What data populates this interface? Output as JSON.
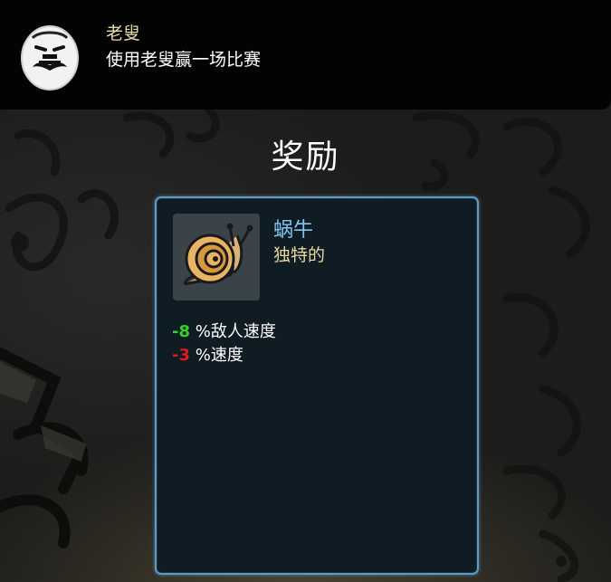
{
  "banner": {
    "character_name": "老叟",
    "description": "使用老叟赢一场比赛",
    "icon": "old-man-egg-icon"
  },
  "reward": {
    "title": "奖励",
    "item": {
      "name": "蜗牛",
      "rarity": "独特的",
      "icon": "snail-icon",
      "stats": [
        {
          "value": "-8",
          "label": "%敌人速度",
          "color": "#34d321"
        },
        {
          "value": "-3",
          "label": "%速度",
          "color": "#e0191f"
        }
      ]
    }
  },
  "colors": {
    "panel_border": "#5d9ac6",
    "item_name": "#7fc6f0",
    "rarity": "#e6d69a",
    "character_name": "#e9d9a8"
  }
}
